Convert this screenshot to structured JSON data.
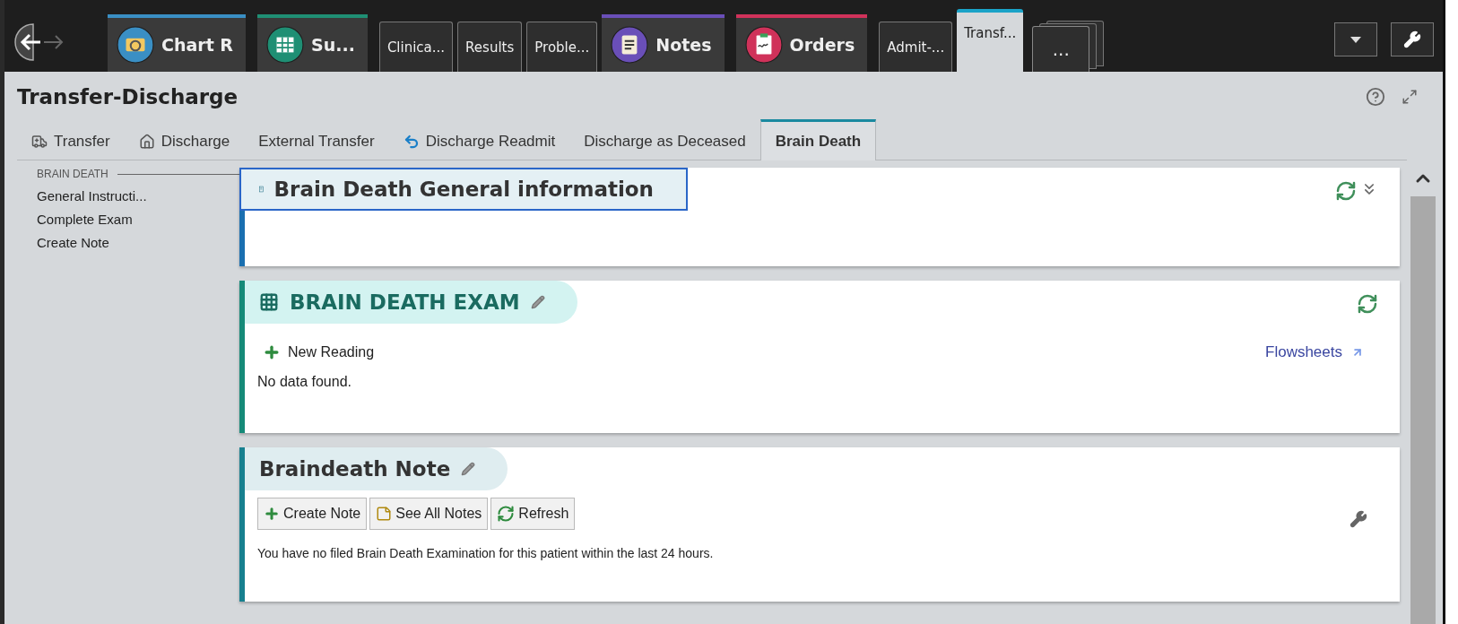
{
  "top_tabs": [
    {
      "label": "Chart R",
      "kind": "chart",
      "color": "#3a8fc4",
      "selected": false
    },
    {
      "label": "Su...",
      "kind": "grid",
      "color": "#1f8f74",
      "selected": false
    },
    {
      "label": "Clinica...",
      "kind": "plain",
      "selected": false
    },
    {
      "label": "Results",
      "kind": "plain",
      "selected": false
    },
    {
      "label": "Proble...",
      "kind": "plain",
      "selected": false
    },
    {
      "label": "Notes",
      "kind": "note",
      "color": "#6a4fb8",
      "selected": false
    },
    {
      "label": "Orders",
      "kind": "orders",
      "color": "#d0325a",
      "selected": false
    },
    {
      "label": "Admit-...",
      "kind": "plain",
      "selected": false
    },
    {
      "label": "Transf...",
      "kind": "plain",
      "selected": true
    },
    {
      "label": "...",
      "kind": "more",
      "selected": false
    }
  ],
  "page_title": "Transfer-Discharge",
  "sub_tabs": [
    {
      "label": "Transfer",
      "kind": "transfer",
      "selected": false
    },
    {
      "label": "Discharge",
      "kind": "discharge",
      "selected": false
    },
    {
      "label": "External Transfer",
      "kind": "plain",
      "selected": false
    },
    {
      "label": "Discharge Readmit",
      "kind": "readmit",
      "selected": false
    },
    {
      "label": "Discharge as Deceased",
      "kind": "plain",
      "selected": false
    },
    {
      "label": "Brain Death",
      "kind": "plain",
      "selected": true
    }
  ],
  "sidebar": {
    "heading": "BRAIN DEATH",
    "items": [
      "General Instructi...",
      "Complete Exam",
      "Create Note"
    ]
  },
  "cards": [
    {
      "kind": "info",
      "title": "Brain Death General information",
      "focused": true
    },
    {
      "kind": "exam",
      "title": "BRAIN DEATH EXAM",
      "focused": false,
      "action": "New Reading",
      "link": "Flowsheets",
      "message": "No data found."
    },
    {
      "kind": "note",
      "title": "Braindeath Note",
      "focused": false,
      "buttons": [
        {
          "label": "Create Note",
          "kind": "add"
        },
        {
          "label": "See All Notes",
          "kind": "notes"
        },
        {
          "label": "Refresh",
          "kind": "refresh"
        }
      ],
      "message": "You have no filed Brain Death Examination for this patient within the last 24 hours."
    }
  ]
}
